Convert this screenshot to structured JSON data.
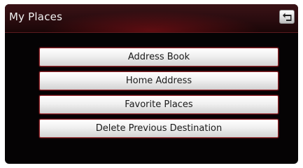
{
  "header": {
    "title": "My Places",
    "back_icon": "back-arrow-icon"
  },
  "menu": {
    "items": [
      {
        "label": "Address Book"
      },
      {
        "label": "Home Address"
      },
      {
        "label": "Favorite Places"
      },
      {
        "label": "Delete Previous Destination"
      }
    ]
  },
  "colors": {
    "header_red": "#2a0c0f",
    "screen_bg": "#050304",
    "button_border": "#9a2a2e"
  }
}
